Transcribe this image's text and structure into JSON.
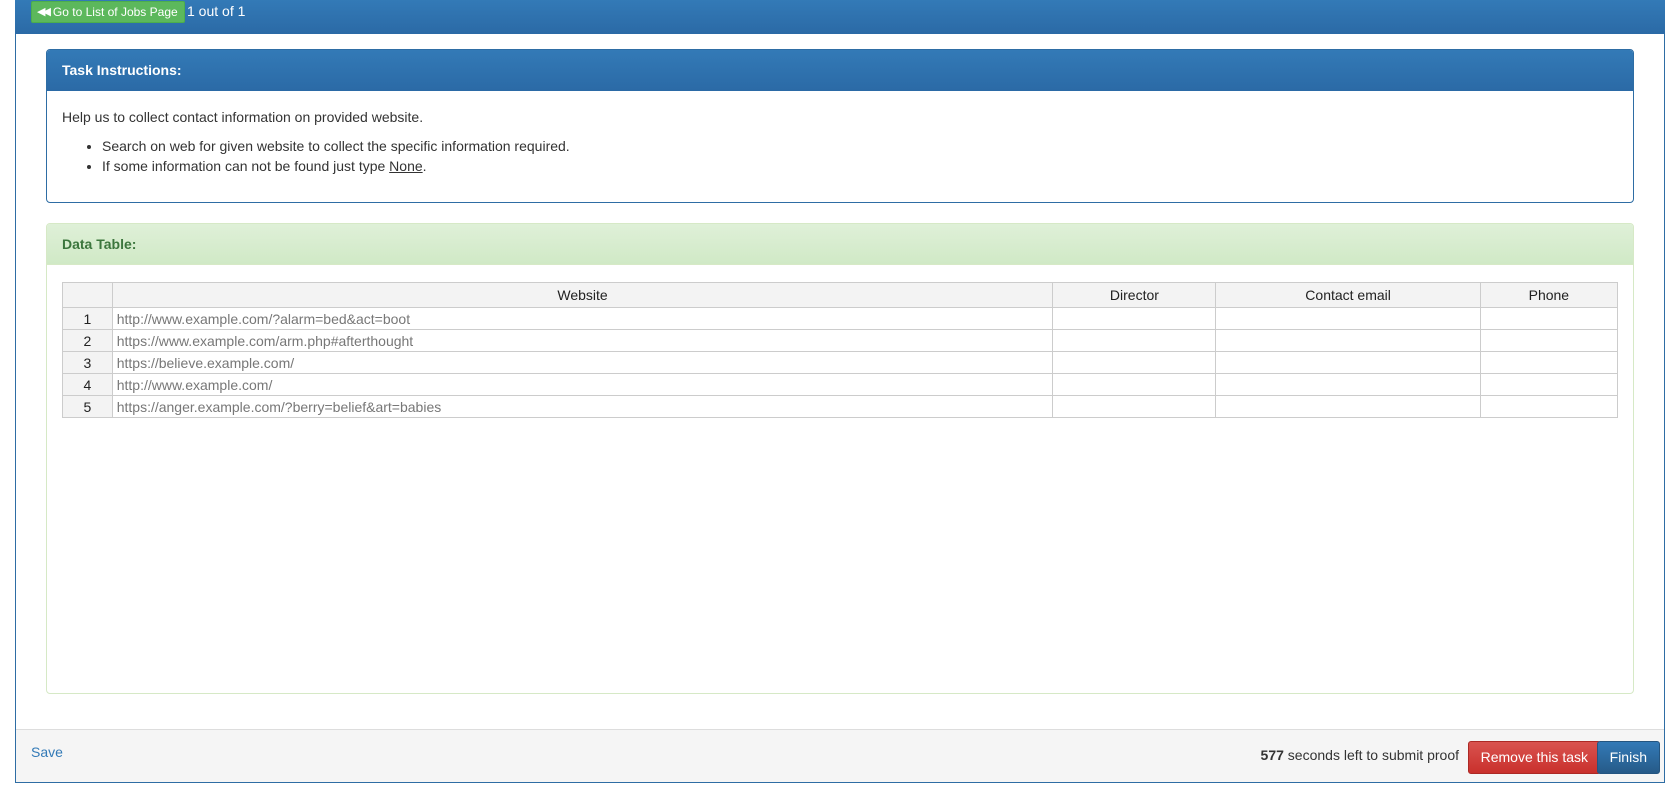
{
  "topbar": {
    "back_button_label": "Go to List of Jobs Page",
    "counter": "1 out of 1"
  },
  "instructions": {
    "title": "Task Instructions:",
    "intro": "Help us to collect contact information on provided website.",
    "bullets": [
      "Search on web for given website to collect the specific information required.",
      "If some information can not be found just type "
    ],
    "none_word": "None",
    "after_none": "."
  },
  "data_table": {
    "title": "Data Table:",
    "columns": [
      "",
      "Website",
      "Director",
      "Contact email",
      "Phone"
    ],
    "rows": [
      {
        "num": "1",
        "website": "http://www.example.com/?alarm=bed&act=boot",
        "director": "",
        "email": "",
        "phone": ""
      },
      {
        "num": "2",
        "website": "https://www.example.com/arm.php#afterthought",
        "director": "",
        "email": "",
        "phone": ""
      },
      {
        "num": "3",
        "website": "https://believe.example.com/",
        "director": "",
        "email": "",
        "phone": ""
      },
      {
        "num": "4",
        "website": "http://www.example.com/",
        "director": "",
        "email": "",
        "phone": ""
      },
      {
        "num": "5",
        "website": "https://anger.example.com/?berry=belief&art=babies",
        "director": "",
        "email": "",
        "phone": ""
      }
    ]
  },
  "footer": {
    "save_label": "Save",
    "seconds_left": "577",
    "timer_text": " seconds left to submit proof",
    "remove_label": "Remove this task",
    "finish_label": "Finish"
  },
  "icons": {
    "back": "double-chevron-left-icon"
  },
  "colors": {
    "primary": "#337ab7",
    "success_bg": "#dff0d8",
    "success_text": "#3c763d",
    "danger": "#d9534f",
    "green_button": "#5cb85c"
  }
}
